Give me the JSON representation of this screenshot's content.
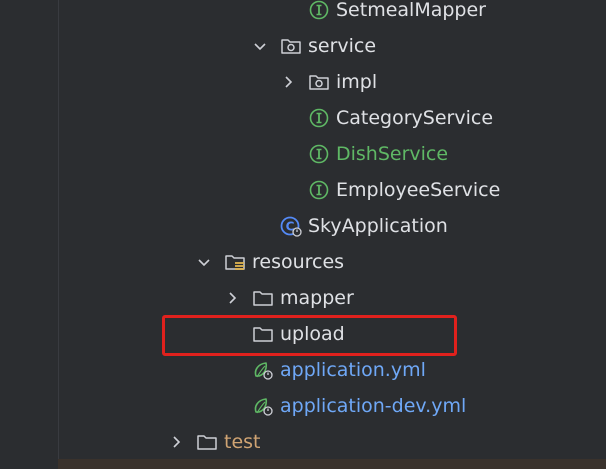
{
  "tree": {
    "items": [
      {
        "label": "SetmealMapper",
        "icon": "interface-icon"
      },
      {
        "label": "service",
        "icon": "package-icon",
        "expanded": true
      },
      {
        "label": "impl",
        "icon": "package-icon",
        "expanded": false
      },
      {
        "label": "CategoryService",
        "icon": "interface-icon"
      },
      {
        "label": "DishService",
        "icon": "interface-icon",
        "color": "#5fb865"
      },
      {
        "label": "EmployeeService",
        "icon": "interface-icon"
      },
      {
        "label": "SkyApplication",
        "icon": "spring-boot-app-icon"
      },
      {
        "label": "resources",
        "icon": "resources-folder-icon",
        "expanded": true
      },
      {
        "label": "mapper",
        "icon": "folder-icon",
        "expanded": false
      },
      {
        "label": "upload",
        "icon": "folder-icon",
        "highlighted": true,
        "highlight_color": "#e0211d"
      },
      {
        "label": "application.yml",
        "icon": "spring-config-icon",
        "color": "#6fa8f7"
      },
      {
        "label": "application-dev.yml",
        "icon": "spring-config-icon",
        "color": "#6fa8f7"
      },
      {
        "label": "test",
        "icon": "folder-icon",
        "expanded": false,
        "color": "#d0a473"
      }
    ]
  },
  "colors": {
    "background": "#2b2d30",
    "text": "#dfe1e5",
    "interface_icon": "#5fb865",
    "modified_file": "#6fa8f7",
    "test_folder": "#d0a473"
  }
}
